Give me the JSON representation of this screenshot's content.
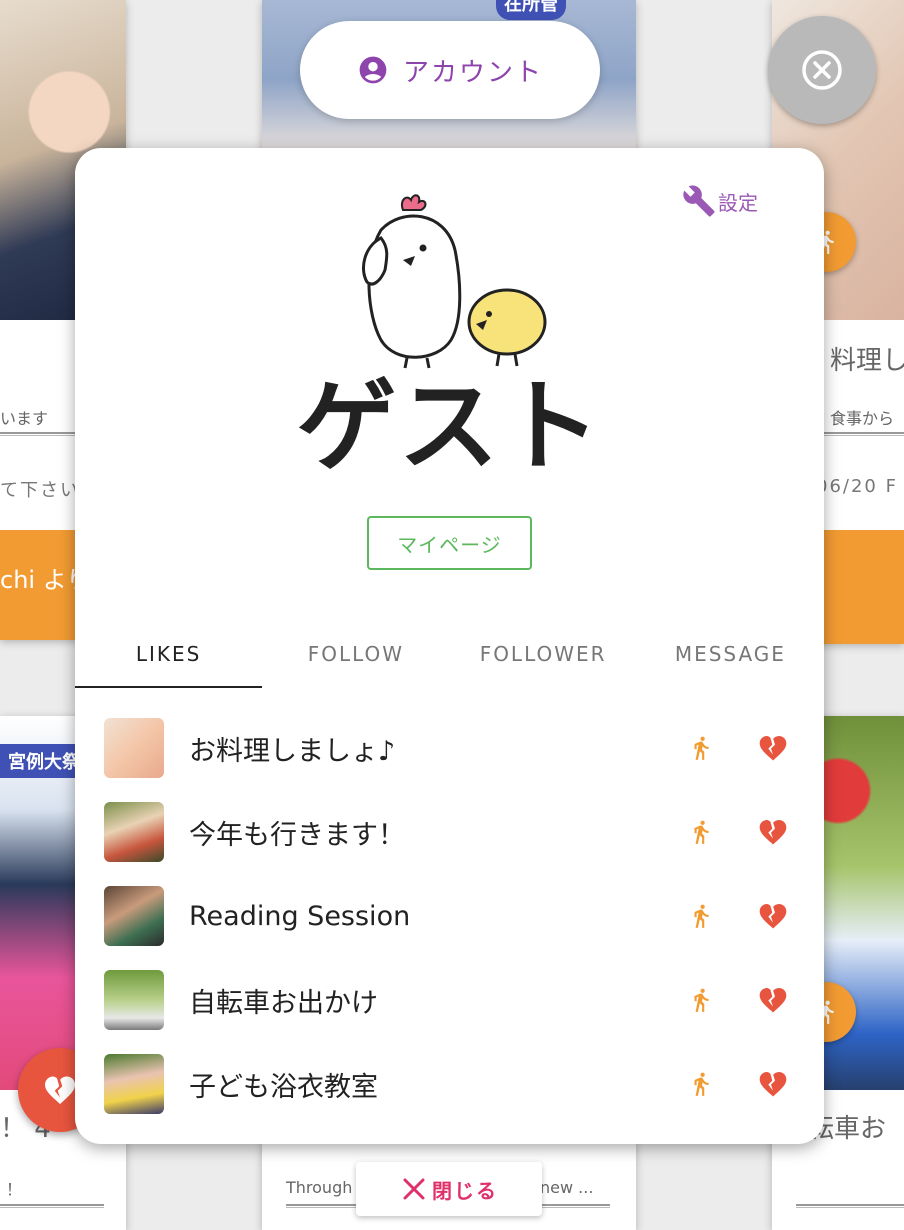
{
  "background": {
    "left_top": {
      "subtitle": "います",
      "date": "て下さい",
      "band_text": "chi より"
    },
    "right_top": {
      "title": "料理し",
      "subtitle": "食事から",
      "date": "06/20 F"
    },
    "left_bottom": {
      "tag": "宮例大祭",
      "title": "！ 4",
      "subtitle": "！"
    },
    "center_bottom": {
      "text_left": "Through",
      "text_right": "new ..."
    },
    "right_bottom": {
      "title": "転車お"
    },
    "top_badge": "在所管"
  },
  "account": {
    "label": "アカウント"
  },
  "modal": {
    "settings_label": "設定",
    "user_name": "ゲスト",
    "mypage_label": "マイページ",
    "tabs": [
      {
        "label": "LIKES",
        "active": true
      },
      {
        "label": "FOLLOW",
        "active": false
      },
      {
        "label": "FOLLOWER",
        "active": false
      },
      {
        "label": "MESSAGE",
        "active": false
      }
    ],
    "likes": [
      {
        "title": "お料理しましょ♪"
      },
      {
        "title": "今年も行きます！"
      },
      {
        "title": "Reading Session"
      },
      {
        "title": "自転車お出かけ"
      },
      {
        "title": "子ども浴衣教室"
      }
    ]
  },
  "close_button": {
    "label": "閉じる"
  },
  "colors": {
    "accent_purple": "#8e44ad",
    "orange": "#f29b32",
    "heart_red": "#e8553e",
    "green": "#5cb85c",
    "close_pink": "#e0306a"
  }
}
